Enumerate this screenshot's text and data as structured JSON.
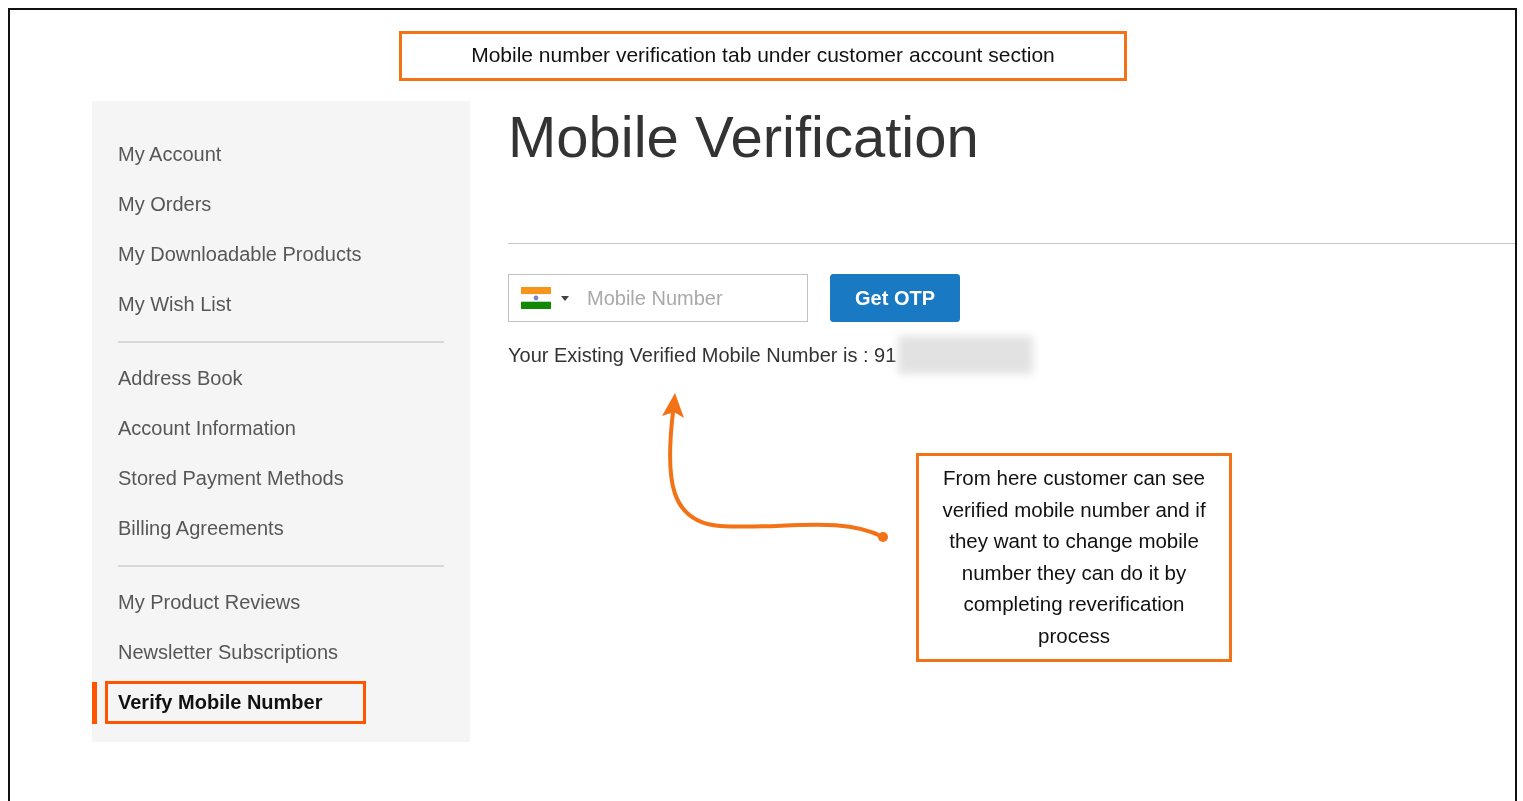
{
  "annotation_top": "Mobile number verification tab under customer account section",
  "sidebar": {
    "groups": [
      {
        "items": [
          {
            "label": "My Account",
            "selected": false
          },
          {
            "label": "My Orders",
            "selected": false
          },
          {
            "label": "My Downloadable Products",
            "selected": false
          },
          {
            "label": "My Wish List",
            "selected": false
          }
        ]
      },
      {
        "items": [
          {
            "label": "Address Book",
            "selected": false
          },
          {
            "label": "Account Information",
            "selected": false
          },
          {
            "label": "Stored Payment Methods",
            "selected": false
          },
          {
            "label": "Billing Agreements",
            "selected": false
          }
        ]
      },
      {
        "items": [
          {
            "label": "My Product Reviews",
            "selected": false
          },
          {
            "label": "Newsletter Subscriptions",
            "selected": false
          },
          {
            "label": "Verify Mobile Number",
            "selected": true
          }
        ]
      }
    ]
  },
  "page_title": "Mobile Verification",
  "mobile_field": {
    "placeholder": "Mobile Number"
  },
  "get_otp_button": "Get OTP",
  "existing_number": "Your Existing Verified Mobile Number is : 91",
  "callout": "From here customer can see verified mobile number and if they want to change mobile number they can do it by completing reverification process"
}
